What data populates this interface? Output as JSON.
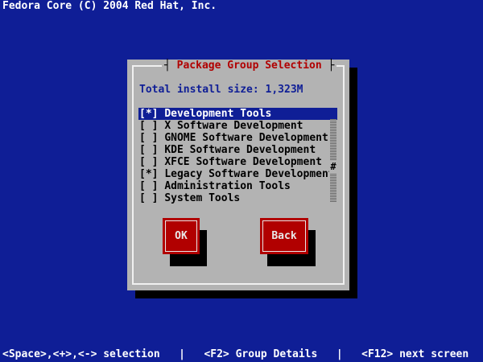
{
  "banner": {
    "text": "Fedora Core (C) 2004 Red Hat, Inc."
  },
  "dialog": {
    "title": "Package Group Selection",
    "install_size": "Total install size: 1,323M",
    "groups": [
      {
        "mark": "[*]",
        "label": "Development Tools",
        "selected": true
      },
      {
        "mark": "[ ]",
        "label": "X Software Development",
        "selected": false
      },
      {
        "mark": "[ ]",
        "label": "GNOME Software Development",
        "selected": false
      },
      {
        "mark": "[ ]",
        "label": "KDE Software Development",
        "selected": false
      },
      {
        "mark": "[ ]",
        "label": "XFCE Software Development",
        "selected": false
      },
      {
        "mark": "[*]",
        "label": "Legacy Software Development",
        "selected": false
      },
      {
        "mark": "[ ]",
        "label": "Administration Tools",
        "selected": false
      },
      {
        "mark": "[ ]",
        "label": "System Tools",
        "selected": false
      }
    ],
    "scroll_thumb": "#",
    "ok_label": "OK",
    "back_label": "Back"
  },
  "status_bar": {
    "text": "<Space>,<+>,<-> selection   |   <F2> Group Details   |   <F12> next screen"
  },
  "colors": {
    "background": "#0f1e96",
    "dialog": "#b3b3b3",
    "accent": "#b10000",
    "highlight": "#0f1e96"
  }
}
